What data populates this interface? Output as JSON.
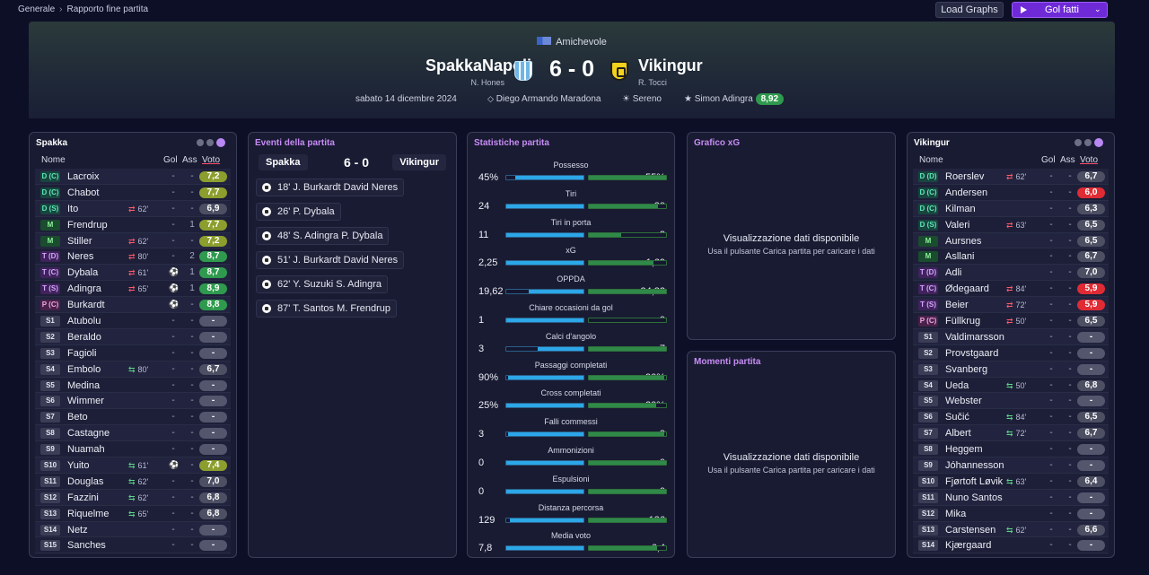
{
  "breadcrumb": {
    "root": "Generale",
    "current": "Rapporto fine partita"
  },
  "toolbar": {
    "load_graphs": "Load Graphs",
    "goals_dropdown": "Gol fatti"
  },
  "match": {
    "competition": "Amichevole",
    "home_team": "SpakkaNapoli",
    "home_manager": "N. Hones",
    "away_team": "Vikingur",
    "away_manager": "R. Tocci",
    "score": "6 - 0",
    "date": "sabato 14 dicembre 2024",
    "stadium": "Diego Armando Maradona",
    "weather": "Sereno",
    "mvp_name": "Simon Adingra",
    "mvp_rating": "8,92"
  },
  "columns": {
    "name": "Nome",
    "goals": "Gol",
    "assists": "Ass",
    "rating": "Voto"
  },
  "home_panel": {
    "title": "Spakka",
    "players": [
      {
        "pos": "D (C)",
        "cls": "d",
        "name": "Lacroix",
        "sub": "",
        "goals": "-",
        "assists": "-",
        "rating": "7,2",
        "rc": "v-g1"
      },
      {
        "pos": "D (C)",
        "cls": "d",
        "name": "Chabot",
        "sub": "",
        "goals": "-",
        "assists": "-",
        "rating": "7,7",
        "rc": "v-g1"
      },
      {
        "pos": "D (S)",
        "cls": "d",
        "name": "Ito",
        "sub": "62'",
        "subdir": "out",
        "goals": "-",
        "assists": "-",
        "rating": "6,9",
        "rc": "v-grey"
      },
      {
        "pos": "M",
        "cls": "m",
        "name": "Frendrup",
        "sub": "",
        "goals": "-",
        "assists": "1",
        "rating": "7,7",
        "rc": "v-g1"
      },
      {
        "pos": "M",
        "cls": "m",
        "name": "Stiller",
        "sub": "62'",
        "subdir": "out",
        "goals": "-",
        "assists": "-",
        "rating": "7,2",
        "rc": "v-g1"
      },
      {
        "pos": "T (D)",
        "cls": "t",
        "name": "Neres",
        "sub": "80'",
        "subdir": "out",
        "goals": "-",
        "assists": "2",
        "rating": "8,7",
        "rc": "v-g3"
      },
      {
        "pos": "T (C)",
        "cls": "t",
        "name": "Dybala",
        "sub": "61'",
        "subdir": "out",
        "goalicon": true,
        "goals": "",
        "assists": "1",
        "rating": "8,7",
        "rc": "v-g3"
      },
      {
        "pos": "T (S)",
        "cls": "t",
        "name": "Adingra",
        "sub": "65'",
        "subdir": "out",
        "goalicon": true,
        "goals": "",
        "assists": "1",
        "rating": "8,9",
        "rc": "v-g3"
      },
      {
        "pos": "P (C)",
        "cls": "p",
        "name": "Burkardt",
        "sub": "",
        "goalicon": true,
        "goals": "",
        "assists": "-",
        "rating": "8,8",
        "rc": "v-g3"
      },
      {
        "pos": "S1",
        "cls": "s",
        "name": "Atubolu",
        "sub": "",
        "goals": "-",
        "assists": "-",
        "rating": "-",
        "rc": "v-dash"
      },
      {
        "pos": "S2",
        "cls": "s",
        "name": "Beraldo",
        "sub": "",
        "goals": "-",
        "assists": "-",
        "rating": "-",
        "rc": "v-dash"
      },
      {
        "pos": "S3",
        "cls": "s",
        "name": "Fagioli",
        "sub": "",
        "goals": "-",
        "assists": "-",
        "rating": "-",
        "rc": "v-dash"
      },
      {
        "pos": "S4",
        "cls": "s",
        "name": "Embolo",
        "sub": "80'",
        "subdir": "in",
        "goals": "-",
        "assists": "-",
        "rating": "6,7",
        "rc": "v-grey"
      },
      {
        "pos": "S5",
        "cls": "s",
        "name": "Medina",
        "sub": "",
        "goals": "-",
        "assists": "-",
        "rating": "-",
        "rc": "v-dash"
      },
      {
        "pos": "S6",
        "cls": "s",
        "name": "Wimmer",
        "sub": "",
        "goals": "-",
        "assists": "-",
        "rating": "-",
        "rc": "v-dash"
      },
      {
        "pos": "S7",
        "cls": "s",
        "name": "Beto",
        "sub": "",
        "goals": "-",
        "assists": "-",
        "rating": "-",
        "rc": "v-dash"
      },
      {
        "pos": "S8",
        "cls": "s",
        "name": "Castagne",
        "sub": "",
        "goals": "-",
        "assists": "-",
        "rating": "-",
        "rc": "v-dash"
      },
      {
        "pos": "S9",
        "cls": "s",
        "name": "Nuamah",
        "sub": "",
        "goals": "-",
        "assists": "-",
        "rating": "-",
        "rc": "v-dash"
      },
      {
        "pos": "S10",
        "cls": "s",
        "name": "Yuito",
        "sub": "61'",
        "subdir": "in",
        "goalicon": true,
        "goals": "",
        "assists": "-",
        "rating": "7,4",
        "rc": "v-g1"
      },
      {
        "pos": "S11",
        "cls": "s",
        "name": "Douglas",
        "sub": "62'",
        "subdir": "in",
        "goals": "-",
        "assists": "-",
        "rating": "7,0",
        "rc": "v-grey"
      },
      {
        "pos": "S12",
        "cls": "s",
        "name": "Fazzini",
        "sub": "62'",
        "subdir": "in",
        "goals": "-",
        "assists": "-",
        "rating": "6,8",
        "rc": "v-grey"
      },
      {
        "pos": "S13",
        "cls": "s",
        "name": "Riquelme",
        "sub": "65'",
        "subdir": "in",
        "goals": "-",
        "assists": "-",
        "rating": "6,8",
        "rc": "v-grey"
      },
      {
        "pos": "S14",
        "cls": "s",
        "name": "Netz",
        "sub": "",
        "goals": "-",
        "assists": "-",
        "rating": "-",
        "rc": "v-dash"
      },
      {
        "pos": "S15",
        "cls": "s",
        "name": "Sanches",
        "sub": "",
        "goals": "-",
        "assists": "-",
        "rating": "-",
        "rc": "v-dash"
      }
    ]
  },
  "away_panel": {
    "title": "Vikingur",
    "players": [
      {
        "pos": "D (D)",
        "cls": "d",
        "name": "Roerslev",
        "sub": "62'",
        "subdir": "out",
        "goals": "-",
        "assists": "-",
        "rating": "6,7",
        "rc": "v-grey"
      },
      {
        "pos": "D (C)",
        "cls": "d",
        "name": "Andersen",
        "sub": "",
        "goals": "-",
        "assists": "-",
        "rating": "6,0",
        "rc": "v-red"
      },
      {
        "pos": "D (C)",
        "cls": "d",
        "name": "Kilman",
        "sub": "",
        "goals": "-",
        "assists": "-",
        "rating": "6,3",
        "rc": "v-grey"
      },
      {
        "pos": "D (S)",
        "cls": "d",
        "name": "Valeri",
        "sub": "63'",
        "subdir": "out",
        "goals": "-",
        "assists": "-",
        "rating": "6,5",
        "rc": "v-grey"
      },
      {
        "pos": "M",
        "cls": "m",
        "name": "Aursnes",
        "sub": "",
        "goals": "-",
        "assists": "-",
        "rating": "6,5",
        "rc": "v-grey"
      },
      {
        "pos": "M",
        "cls": "m",
        "name": "Asllani",
        "sub": "",
        "goals": "-",
        "assists": "-",
        "rating": "6,7",
        "rc": "v-grey"
      },
      {
        "pos": "T (D)",
        "cls": "t",
        "name": "Adli",
        "sub": "",
        "goals": "-",
        "assists": "-",
        "rating": "7,0",
        "rc": "v-grey"
      },
      {
        "pos": "T (C)",
        "cls": "t",
        "name": "Ødegaard",
        "sub": "84'",
        "subdir": "out",
        "goals": "-",
        "assists": "-",
        "rating": "5,9",
        "rc": "v-red"
      },
      {
        "pos": "T (S)",
        "cls": "t",
        "name": "Beier",
        "sub": "72'",
        "subdir": "out",
        "goals": "-",
        "assists": "-",
        "rating": "5,9",
        "rc": "v-red"
      },
      {
        "pos": "P (C)",
        "cls": "p",
        "name": "Füllkrug",
        "sub": "50'",
        "subdir": "out",
        "goals": "-",
        "assists": "-",
        "rating": "6,5",
        "rc": "v-grey"
      },
      {
        "pos": "S1",
        "cls": "s",
        "name": "Valdimarsson",
        "sub": "",
        "goals": "-",
        "assists": "-",
        "rating": "-",
        "rc": "v-dash"
      },
      {
        "pos": "S2",
        "cls": "s",
        "name": "Provstgaard",
        "sub": "",
        "goals": "-",
        "assists": "-",
        "rating": "-",
        "rc": "v-dash"
      },
      {
        "pos": "S3",
        "cls": "s",
        "name": "Svanberg",
        "sub": "",
        "goals": "-",
        "assists": "-",
        "rating": "-",
        "rc": "v-dash"
      },
      {
        "pos": "S4",
        "cls": "s",
        "name": "Ueda",
        "sub": "50'",
        "subdir": "in",
        "goals": "-",
        "assists": "-",
        "rating": "6,8",
        "rc": "v-grey"
      },
      {
        "pos": "S5",
        "cls": "s",
        "name": "Webster",
        "sub": "",
        "goals": "-",
        "assists": "-",
        "rating": "-",
        "rc": "v-dash"
      },
      {
        "pos": "S6",
        "cls": "s",
        "name": "Sučić",
        "sub": "84'",
        "subdir": "in",
        "goals": "-",
        "assists": "-",
        "rating": "6,5",
        "rc": "v-grey"
      },
      {
        "pos": "S7",
        "cls": "s",
        "name": "Albert",
        "sub": "72'",
        "subdir": "in",
        "goals": "-",
        "assists": "-",
        "rating": "6,7",
        "rc": "v-grey"
      },
      {
        "pos": "S8",
        "cls": "s",
        "name": "Heggem",
        "sub": "",
        "goals": "-",
        "assists": "-",
        "rating": "-",
        "rc": "v-dash"
      },
      {
        "pos": "S9",
        "cls": "s",
        "name": "Jóhannesson",
        "sub": "",
        "goals": "-",
        "assists": "-",
        "rating": "-",
        "rc": "v-dash"
      },
      {
        "pos": "S10",
        "cls": "s",
        "name": "Fjørtoft Løvik",
        "sub": "63'",
        "subdir": "in",
        "goals": "-",
        "assists": "-",
        "rating": "6,4",
        "rc": "v-grey"
      },
      {
        "pos": "S11",
        "cls": "s",
        "name": "Nuno Santos",
        "sub": "",
        "goals": "-",
        "assists": "-",
        "rating": "-",
        "rc": "v-dash"
      },
      {
        "pos": "S12",
        "cls": "s",
        "name": "Mika",
        "sub": "",
        "goals": "-",
        "assists": "-",
        "rating": "-",
        "rc": "v-dash"
      },
      {
        "pos": "S13",
        "cls": "s",
        "name": "Carstensen",
        "sub": "62'",
        "subdir": "in",
        "goals": "-",
        "assists": "-",
        "rating": "6,6",
        "rc": "v-grey"
      },
      {
        "pos": "S14",
        "cls": "s",
        "name": "Kjærgaard",
        "sub": "",
        "goals": "-",
        "assists": "-",
        "rating": "-",
        "rc": "v-dash"
      }
    ]
  },
  "events_panel": {
    "title": "Eventi della partita",
    "home": "Spakka",
    "away": "Vikingur",
    "score": "6 - 0",
    "events": [
      "18' J. Burkardt David Neres",
      "26' P. Dybala",
      "48' S. Adingra P. Dybala",
      "51' J. Burkardt David Neres",
      "62' Y. Suzuki S. Adingra",
      "87' T. Santos M. Frendrup"
    ]
  },
  "stats_panel": {
    "title": "Statistiche partita",
    "stats": [
      {
        "label": "Possesso",
        "home": "45%",
        "away": "55%",
        "hv": 45,
        "av": 55
      },
      {
        "label": "Tiri",
        "home": "24",
        "away": "20",
        "hv": 24,
        "av": 20
      },
      {
        "label": "Tiri in porta",
        "home": "11",
        "away": "3",
        "hv": 11,
        "av": 3
      },
      {
        "label": "xG",
        "home": "2,25",
        "away": "1,69",
        "hv": 2.25,
        "av": 1.69
      },
      {
        "label": "OPPDA",
        "home": "19,62",
        "away": "34,82",
        "hv": 19.62,
        "av": 34.82
      },
      {
        "label": "Chiare occasioni da gol",
        "home": "1",
        "away": "0",
        "hv": 1,
        "av": 0
      },
      {
        "label": "Calci d'angolo",
        "home": "3",
        "away": "7",
        "hv": 3,
        "av": 7
      },
      {
        "label": "Passaggi completati",
        "home": "90%",
        "away": "90%",
        "hv": 90,
        "av": 90
      },
      {
        "label": "Cross completati",
        "home": "25%",
        "away": "20%",
        "hv": 25,
        "av": 20
      },
      {
        "label": "Falli commessi",
        "home": "3",
        "away": "3",
        "hv": 3,
        "av": 3
      },
      {
        "label": "Ammonizioni",
        "home": "0",
        "away": "0",
        "hv": 0,
        "av": 0
      },
      {
        "label": "Espulsioni",
        "home": "0",
        "away": "0",
        "hv": 0,
        "av": 0
      },
      {
        "label": "Distanza percorsa",
        "home": "129",
        "away": "136",
        "hv": 129,
        "av": 136
      },
      {
        "label": "Media voto",
        "home": "7,8",
        "away": "6,4",
        "hv": 7.8,
        "av": 6.4
      }
    ]
  },
  "xg_panel": {
    "title": "Grafico xG",
    "nodata": "Visualizzazione dati disponibile",
    "hint": "Usa il pulsante Carica partita per caricare i dati"
  },
  "moments_panel": {
    "title": "Momenti partita",
    "nodata": "Visualizzazione dati disponibile",
    "hint": "Usa il pulsante Carica partita per caricare i dati"
  },
  "colors": {
    "accent": "#6f2ad8",
    "home_bar": "#2ca7e8",
    "away_bar": "#2f8a4a",
    "panel_title_purple": "#c78cf5"
  }
}
